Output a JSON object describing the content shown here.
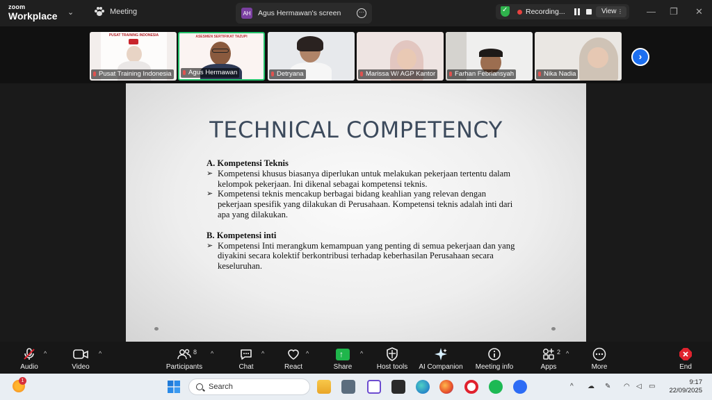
{
  "app": {
    "brand_line1": "zoom",
    "brand_line2": "Workplace"
  },
  "header": {
    "meeting_label": "Meeting",
    "share_initials": "AH",
    "share_label": "Agus Hermawan's screen",
    "recording_label": "Recording...",
    "view_label": "View"
  },
  "participants_strip": [
    {
      "name": "Pusat Training Indonesia",
      "tile_text": "PUSAT TRAINING INDONESIA"
    },
    {
      "name": "Agus Hermawan",
      "tile_text": "ASESMEN SERTIFIKAT TAZUPI"
    },
    {
      "name": "Detryana"
    },
    {
      "name": "Marissa W/ AGP Kantor"
    },
    {
      "name": "Farhan Febriansyah"
    },
    {
      "name": "Nika Nadia"
    }
  ],
  "slide": {
    "title": "TECHNICAL COMPETENCY",
    "section_a": {
      "heading": "A.  Kompetensi Teknis",
      "bullets": [
        "Kompetensi khusus biasanya diperlukan untuk melakukan pekerjaan tertentu dalam kelompok pekerjaan. Ini dikenal sebagai kompetensi teknis.",
        "Kompetensi teknis mencakup berbagai bidang keahlian yang relevan dengan pekerjaan spesifik yang dilakukan di Perusahaan. Kompetensi teknis adalah inti dari apa yang dilakukan."
      ]
    },
    "section_b": {
      "heading": "B.  Kompetensi inti",
      "bullets": [
        "Kompetensi Inti merangkum kemampuan yang penting di semua pekerjaan dan yang diyakini secara kolektif berkontribusi terhadap keberhasilan Perusahaan secara keseluruhan."
      ]
    }
  },
  "toolbar": {
    "audio": "Audio",
    "video": "Video",
    "participants": "Participants",
    "participants_count": "8",
    "chat": "Chat",
    "react": "React",
    "share": "Share",
    "host_tools": "Host tools",
    "ai_companion": "AI Companion",
    "meeting_info": "Meeting info",
    "apps": "Apps",
    "apps_count": "2",
    "more": "More",
    "end": "End"
  },
  "taskbar": {
    "search_placeholder": "Search",
    "weather_badge": "1",
    "time": "9:17",
    "date": "22/09/2025"
  },
  "colors": {
    "accent_green": "#22c36b",
    "recording_red": "#e8423f",
    "share_green": "#1fb64b",
    "end_red": "#e0232e"
  }
}
